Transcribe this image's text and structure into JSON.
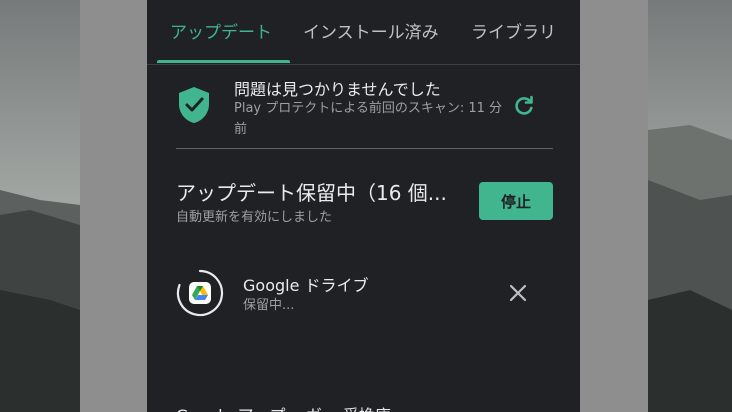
{
  "tabs": [
    {
      "label": "アップデート",
      "active": true
    },
    {
      "label": "インストール済み",
      "active": false
    },
    {
      "label": "ライブラリ",
      "active": false
    }
  ],
  "protect": {
    "title": "問題は見つかりませんでした",
    "subtitle": "Play プロテクトによる前回のスキャン: 11 分前",
    "icon": "shield-check-icon"
  },
  "pending": {
    "title": "アップデート保留中（16 個...",
    "subtitle": "自動更新を有効にしました",
    "stop_label": "停止"
  },
  "apps": [
    {
      "name": "Google ドライブ",
      "status": "保留中..."
    }
  ],
  "next_row_partial": "Google アップ... ガー 受換庫",
  "colors": {
    "accent": "#41b58e",
    "panel_bg": "#202124",
    "scrim": "#8e8e8e"
  }
}
